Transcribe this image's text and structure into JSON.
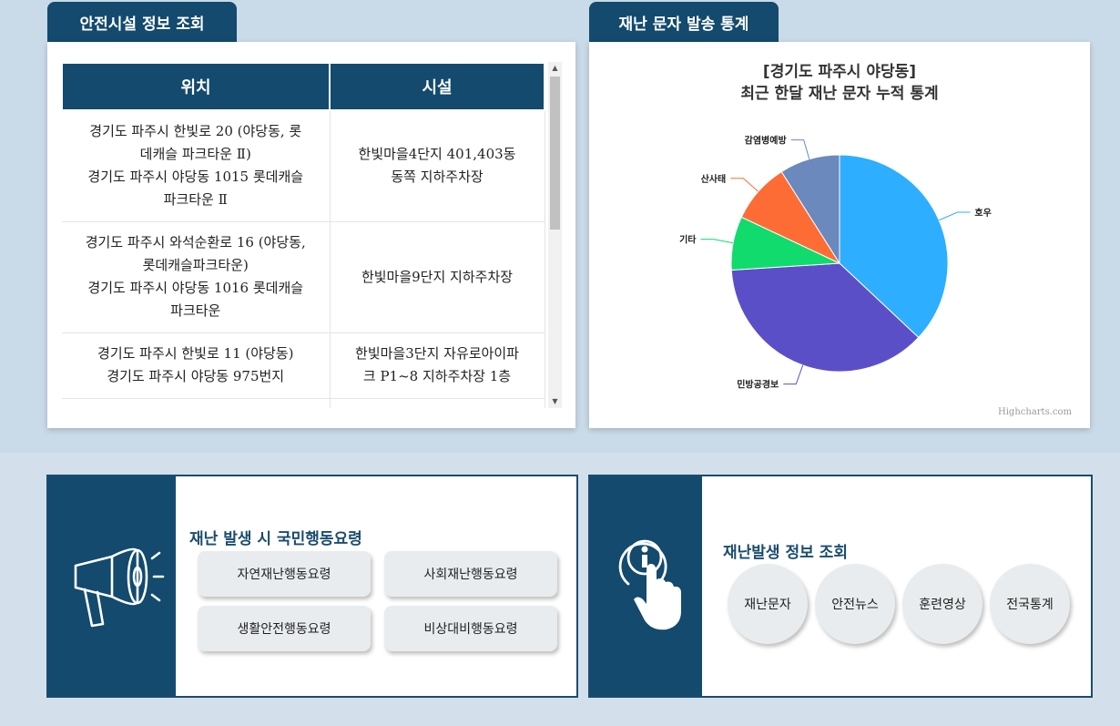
{
  "safety": {
    "tab_label": "안전시설 정보 조회",
    "columns": [
      "위치",
      "시설"
    ],
    "rows": [
      {
        "location": [
          "경기도 파주시 한빛로 20 (야당동, 롯",
          "데캐슬 파크타운 Ⅱ)",
          "경기도 파주시 야당동 1015 롯데캐슬",
          "파크타운 Ⅱ"
        ],
        "facility": [
          "한빛마을4단지 401,403동",
          "동쪽 지하주차장"
        ]
      },
      {
        "location": [
          "경기도 파주시 와석순환로 16 (야당동,",
          "롯데캐슬파크타운)",
          "경기도 파주시 야당동 1016 롯데캐슬",
          "파크타운"
        ],
        "facility": [
          "한빛마을9단지 지하주차장"
        ]
      },
      {
        "location": [
          "경기도 파주시 한빛로 11 (야당동)",
          "경기도 파주시 야당동 975번지"
        ],
        "facility": [
          "한빛마을3단지 자유로아이파",
          "크 P1~8 지하주차장 1층"
        ]
      }
    ]
  },
  "stats": {
    "tab_label": "재난 문자 발송 통계",
    "credit": "Highcharts.com"
  },
  "chart_data": {
    "type": "pie",
    "title_line1": "[경기도 파주시 야당동]",
    "title_line2": "최근 한달 재난 문자 누적 통계",
    "slices": [
      {
        "name": "호우",
        "value": 37,
        "color": "#2eaeff"
      },
      {
        "name": "민방공경보",
        "value": 37,
        "color": "#5b4fc8"
      },
      {
        "name": "기타",
        "value": 8,
        "color": "#11db6c"
      },
      {
        "name": "산사태",
        "value": 9,
        "color": "#fe6c35"
      },
      {
        "name": "감염병예방",
        "value": 9,
        "color": "#6b89bd"
      }
    ]
  },
  "guide": {
    "title": "재난 발생 시 국민행동요령",
    "buttons": [
      "자연재난행동요령",
      "사회재난행동요령",
      "생활안전행동요령",
      "비상대비행동요령"
    ],
    "icon": "megaphone-icon"
  },
  "info": {
    "title": "재난발생 정보 조회",
    "buttons": [
      "재난문자",
      "안전뉴스",
      "훈련영상",
      "전국통계"
    ],
    "icon": "info-touch-icon"
  },
  "colors": {
    "navy": "#134a6e",
    "bg": "#c9dae8"
  }
}
